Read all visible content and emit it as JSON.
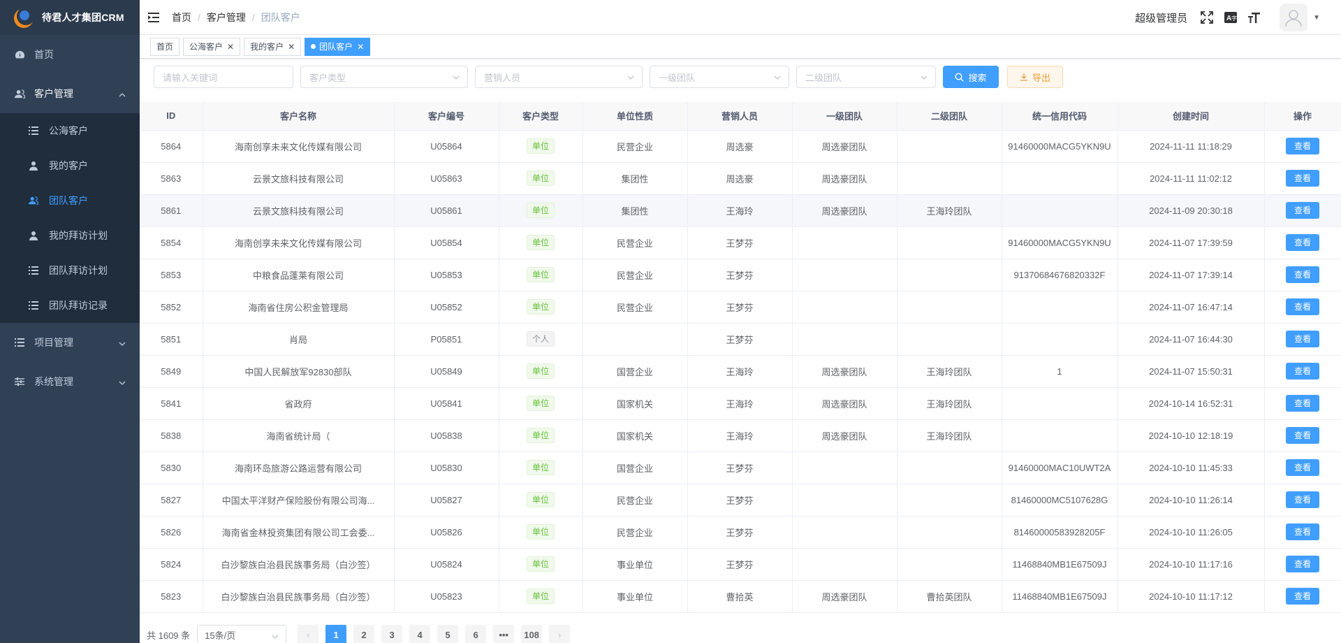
{
  "app": {
    "title": "待君人才集团CRM"
  },
  "sidebar": {
    "items": [
      {
        "label": "首页",
        "icon": "dashboard-icon"
      },
      {
        "label": "客户管理",
        "icon": "users-icon",
        "open": true
      },
      {
        "label": "项目管理",
        "icon": "list-icon"
      },
      {
        "label": "系统管理",
        "icon": "sliders-icon"
      }
    ],
    "customer_sub": [
      {
        "label": "公海客户",
        "icon": "list-icon"
      },
      {
        "label": "我的客户",
        "icon": "user-icon"
      },
      {
        "label": "团队客户",
        "icon": "users-icon",
        "active": true
      },
      {
        "label": "我的拜访计划",
        "icon": "user-icon"
      },
      {
        "label": "团队拜访计划",
        "icon": "list-icon"
      },
      {
        "label": "团队拜访记录",
        "icon": "list-icon"
      }
    ]
  },
  "header": {
    "breadcrumb": [
      "首页",
      "客户管理",
      "团队客户"
    ],
    "username": "超级管理员"
  },
  "tags": [
    {
      "label": "首页",
      "closable": false
    },
    {
      "label": "公海客户",
      "closable": true
    },
    {
      "label": "我的客户",
      "closable": true
    },
    {
      "label": "团队客户",
      "closable": true,
      "active": true
    }
  ],
  "filters": {
    "keyword_placeholder": "请输入关键词",
    "type_placeholder": "客户类型",
    "sales_placeholder": "营销人员",
    "team1_placeholder": "一级团队",
    "team2_placeholder": "二级团队",
    "search_label": "搜索",
    "export_label": "导出"
  },
  "table": {
    "columns": [
      "ID",
      "客户名称",
      "客户编号",
      "客户类型",
      "单位性质",
      "营销人员",
      "一级团队",
      "二级团队",
      "统一信用代码",
      "创建时间",
      "操作"
    ],
    "view_label": "查看",
    "rows": [
      [
        "5864",
        "海南创享未来文化传媒有限公司",
        "U05864",
        "单位",
        "民营企业",
        "周选豪",
        "周选豪团队",
        "",
        "91460000MACG5YKN9U",
        "2024-11-11 11:18:29"
      ],
      [
        "5863",
        "云景文旅科技有限公司",
        "U05863",
        "单位",
        "集团性",
        "周选豪",
        "周选豪团队",
        "",
        "",
        "2024-11-11 11:02:12"
      ],
      [
        "5861",
        "云景文旅科技有限公司",
        "U05861",
        "单位",
        "集团性",
        "王海玲",
        "周选豪团队",
        "王海玲团队",
        "",
        "2024-11-09 20:30:18"
      ],
      [
        "5854",
        "海南创享未来文化传媒有限公司",
        "U05854",
        "单位",
        "民营企业",
        "王梦芬",
        "",
        "",
        "91460000MACG5YKN9U",
        "2024-11-07 17:39:59"
      ],
      [
        "5853",
        "中粮食品蓬莱有限公司",
        "U05853",
        "单位",
        "民营企业",
        "王梦芬",
        "",
        "",
        "91370684676820332F",
        "2024-11-07 17:39:14"
      ],
      [
        "5852",
        "海南省住房公积金管理局",
        "U05852",
        "单位",
        "民营企业",
        "王梦芬",
        "",
        "",
        "",
        "2024-11-07 16:47:14"
      ],
      [
        "5851",
        "肖局",
        "P05851",
        "个人",
        "",
        "王梦芬",
        "",
        "",
        "",
        "2024-11-07 16:44:30"
      ],
      [
        "5849",
        "中国人民解放军92830部队",
        "U05849",
        "单位",
        "国营企业",
        "王海玲",
        "周选豪团队",
        "王海玲团队",
        "1",
        "2024-11-07 15:50:31"
      ],
      [
        "5841",
        "省政府",
        "U05841",
        "单位",
        "国家机关",
        "王海玲",
        "周选豪团队",
        "王海玲团队",
        "",
        "2024-10-14 16:52:31"
      ],
      [
        "5838",
        "海南省统计局（",
        "U05838",
        "单位",
        "国家机关",
        "王海玲",
        "周选豪团队",
        "王海玲团队",
        "",
        "2024-10-10 12:18:19"
      ],
      [
        "5830",
        "海南环岛旅游公路运营有限公司",
        "U05830",
        "单位",
        "国营企业",
        "王梦芬",
        "",
        "",
        "91460000MAC10UWT2A",
        "2024-10-10 11:45:33"
      ],
      [
        "5827",
        "中国太平洋财产保险股份有限公司海...",
        "U05827",
        "单位",
        "民营企业",
        "王梦芬",
        "",
        "",
        "81460000MC5107628G",
        "2024-10-10 11:26:14"
      ],
      [
        "5826",
        "海南省金林投资集团有限公司工会委...",
        "U05826",
        "单位",
        "民营企业",
        "王梦芬",
        "",
        "",
        "81460000583928205F",
        "2024-10-10 11:26:05"
      ],
      [
        "5824",
        "白沙黎族白治县民族事务局（白沙签）",
        "U05824",
        "单位",
        "事业单位",
        "王梦芬",
        "",
        "",
        "11468840MB1E67509J",
        "2024-10-10 11:17:16"
      ],
      [
        "5823",
        "白沙黎族白治县民族事务局（白沙签）",
        "U05823",
        "单位",
        "事业单位",
        "曹拾英",
        "周选豪团队",
        "曹拾英团队",
        "11468840MB1E67509J",
        "2024-10-10 11:17:12"
      ]
    ]
  },
  "pagination": {
    "total": "共 1609 条",
    "page_size": "15条/页",
    "pages": [
      "1",
      "2",
      "3",
      "4",
      "5",
      "6",
      "•••",
      "108"
    ],
    "current": "1"
  }
}
